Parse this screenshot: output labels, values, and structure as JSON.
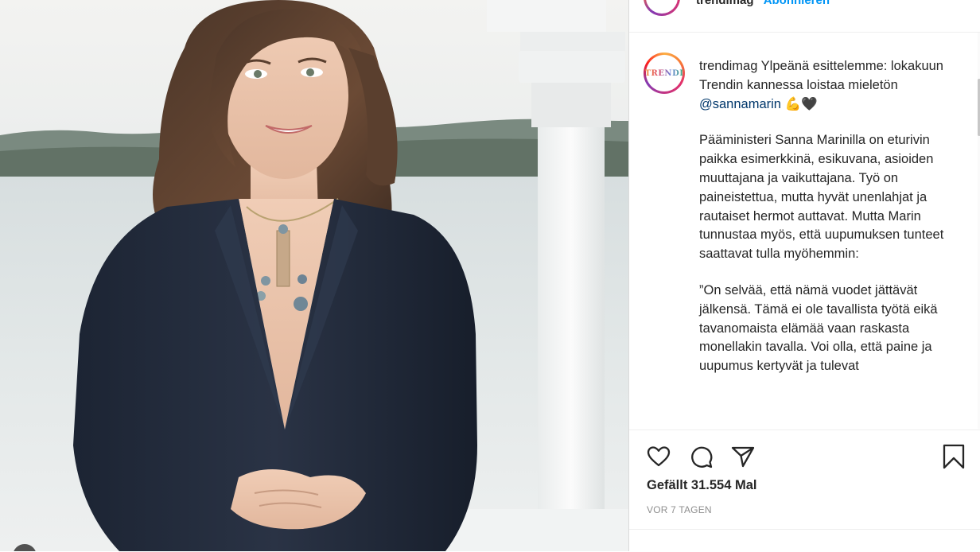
{
  "post": {
    "header": {
      "username": "trendimag",
      "follow_label": "Abonnieren"
    },
    "caption": {
      "username": "trendimag",
      "para1_text": "Ylpeänä esittelemme: lokakuun Trendin kannessa loistaa mieletön ",
      "mention": "@sannamarin",
      "emojis": "💪🖤",
      "para2": "Pääministeri Sanna Marinilla on eturivin paikka esimerkkinä, esikuvana, asioiden muuttajana ja vaikuttajana. Työ on paineistettua, mutta hyvät unenlahjat ja rautaiset hermot auttavat. Mutta Marin tunnustaa myös, että uupumuksen tunteet saattavat tulla myöhemmin:",
      "para3": "”On selvää, että nämä vuodet jättävät jälkensä. Tämä ei ole tavallista työtä eikä tavanomaista elämää vaan raskasta monellakin tavalla. Voi olla, että paine ja uupumus kertyvät ja tulevat"
    },
    "avatar_logo": "TRENDI",
    "likes": "Gefällt 31.554 Mal",
    "timestamp": "VOR 7 TAGEN",
    "icons": {
      "like": "heart-icon",
      "comment": "comment-icon",
      "share": "send-icon",
      "save": "bookmark-icon"
    },
    "colors": {
      "mention": "#00376b",
      "muted": "#8e8e8e",
      "border": "#dbdbdb",
      "follow": "#0095f6"
    }
  }
}
